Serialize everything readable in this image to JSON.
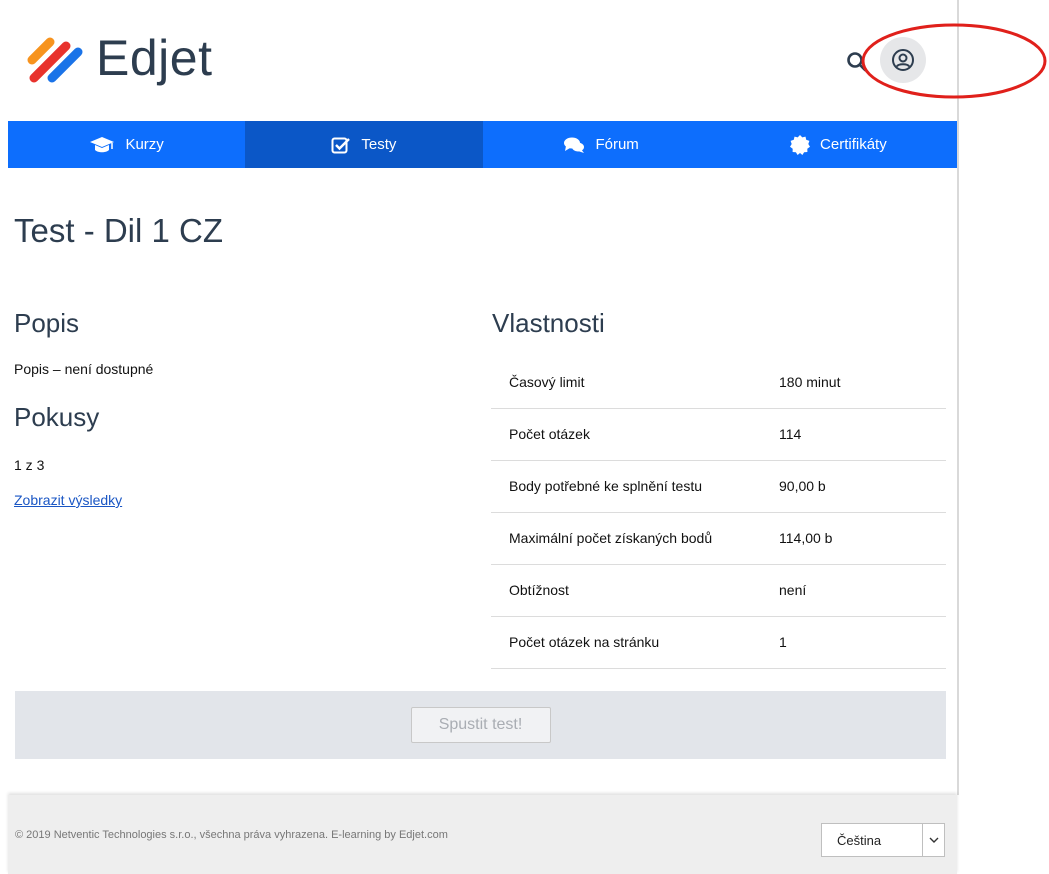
{
  "header": {
    "logo_text": "Edjet",
    "brand_colors": {
      "stripe_orange": "#f7931e",
      "stripe_red": "#e8322d",
      "stripe_blue": "#1a73e8"
    },
    "icons": {
      "search": "search-icon",
      "user": "user-circle-icon"
    }
  },
  "nav": {
    "accent_color": "#0d6efd",
    "active_color": "#0b57c7",
    "items": [
      {
        "label": "Kurzy",
        "icon": "graduation-cap-icon",
        "active": false
      },
      {
        "label": "Testy",
        "icon": "check-square-icon",
        "active": true
      },
      {
        "label": "Fórum",
        "icon": "comments-icon",
        "active": false
      },
      {
        "label": "Certifikáty",
        "icon": "certificate-icon",
        "active": false
      }
    ]
  },
  "main": {
    "title": "Test - Dil 1 CZ",
    "description": {
      "heading": "Popis",
      "text": "Popis – není dostupné"
    },
    "attempts": {
      "heading": "Pokusy",
      "text": "1 z 3",
      "link": "Zobrazit výsledky"
    },
    "properties": {
      "heading": "Vlastnosti",
      "rows": [
        {
          "key": "Časový limit",
          "value": "180 minut"
        },
        {
          "key": "Počet otázek",
          "value": "114"
        },
        {
          "key": "Body potřebné ke splnění testu",
          "value": "90,00 b"
        },
        {
          "key": "Maximální počet získaných bodů",
          "value": "114,00 b"
        },
        {
          "key": "Obtížnost",
          "value": "není"
        },
        {
          "key": "Počet otázek na stránku",
          "value": "1"
        }
      ]
    },
    "start_button": "Spustit test!"
  },
  "footer": {
    "copyright": "© 2019 Netventic Technologies s.r.o., všechna práva vyhrazena. E-learning by Edjet.com",
    "language": "Čeština"
  }
}
